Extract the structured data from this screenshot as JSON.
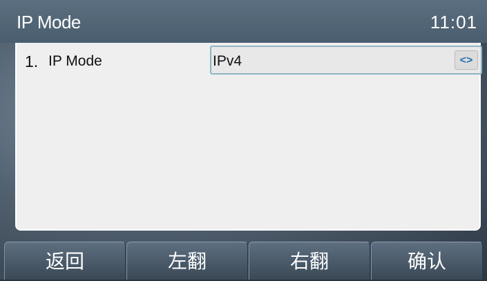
{
  "header": {
    "title": "IP Mode",
    "time": "11:01"
  },
  "settings": [
    {
      "index": "1.",
      "label": "IP Mode",
      "value": "IPv4",
      "switch_icon": "<>"
    }
  ],
  "softkeys": [
    "返回",
    "左翻",
    "右翻",
    "确认"
  ]
}
